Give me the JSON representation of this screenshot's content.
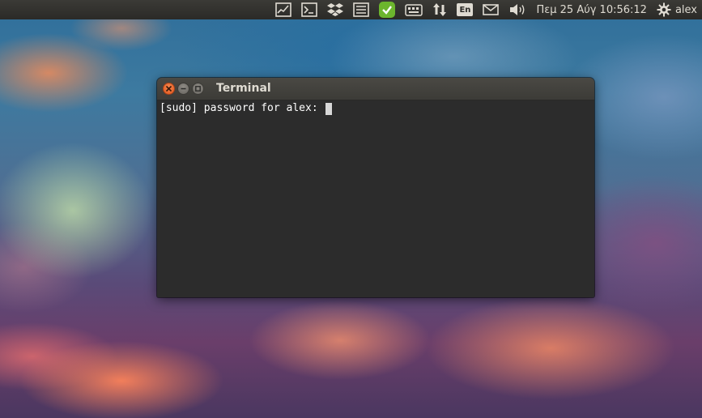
{
  "top_panel": {
    "indicators": [
      {
        "name": "system-monitor-icon"
      },
      {
        "name": "terminal-indicator-icon"
      },
      {
        "name": "dropbox-icon"
      },
      {
        "name": "task-list-icon"
      },
      {
        "name": "security-shield-icon",
        "color": "#6cb52d"
      },
      {
        "name": "keyboard-layout-icon"
      },
      {
        "name": "network-transfer-icon"
      },
      {
        "name": "language-indicator"
      },
      {
        "name": "mail-icon"
      },
      {
        "name": "volume-icon"
      }
    ],
    "language": "En",
    "clock": "Πεμ 25 Αύγ 10:56:12",
    "user": "alex"
  },
  "terminal": {
    "title": "Terminal",
    "line": "[sudo] password for alex: ",
    "close_color": "#e95420"
  }
}
